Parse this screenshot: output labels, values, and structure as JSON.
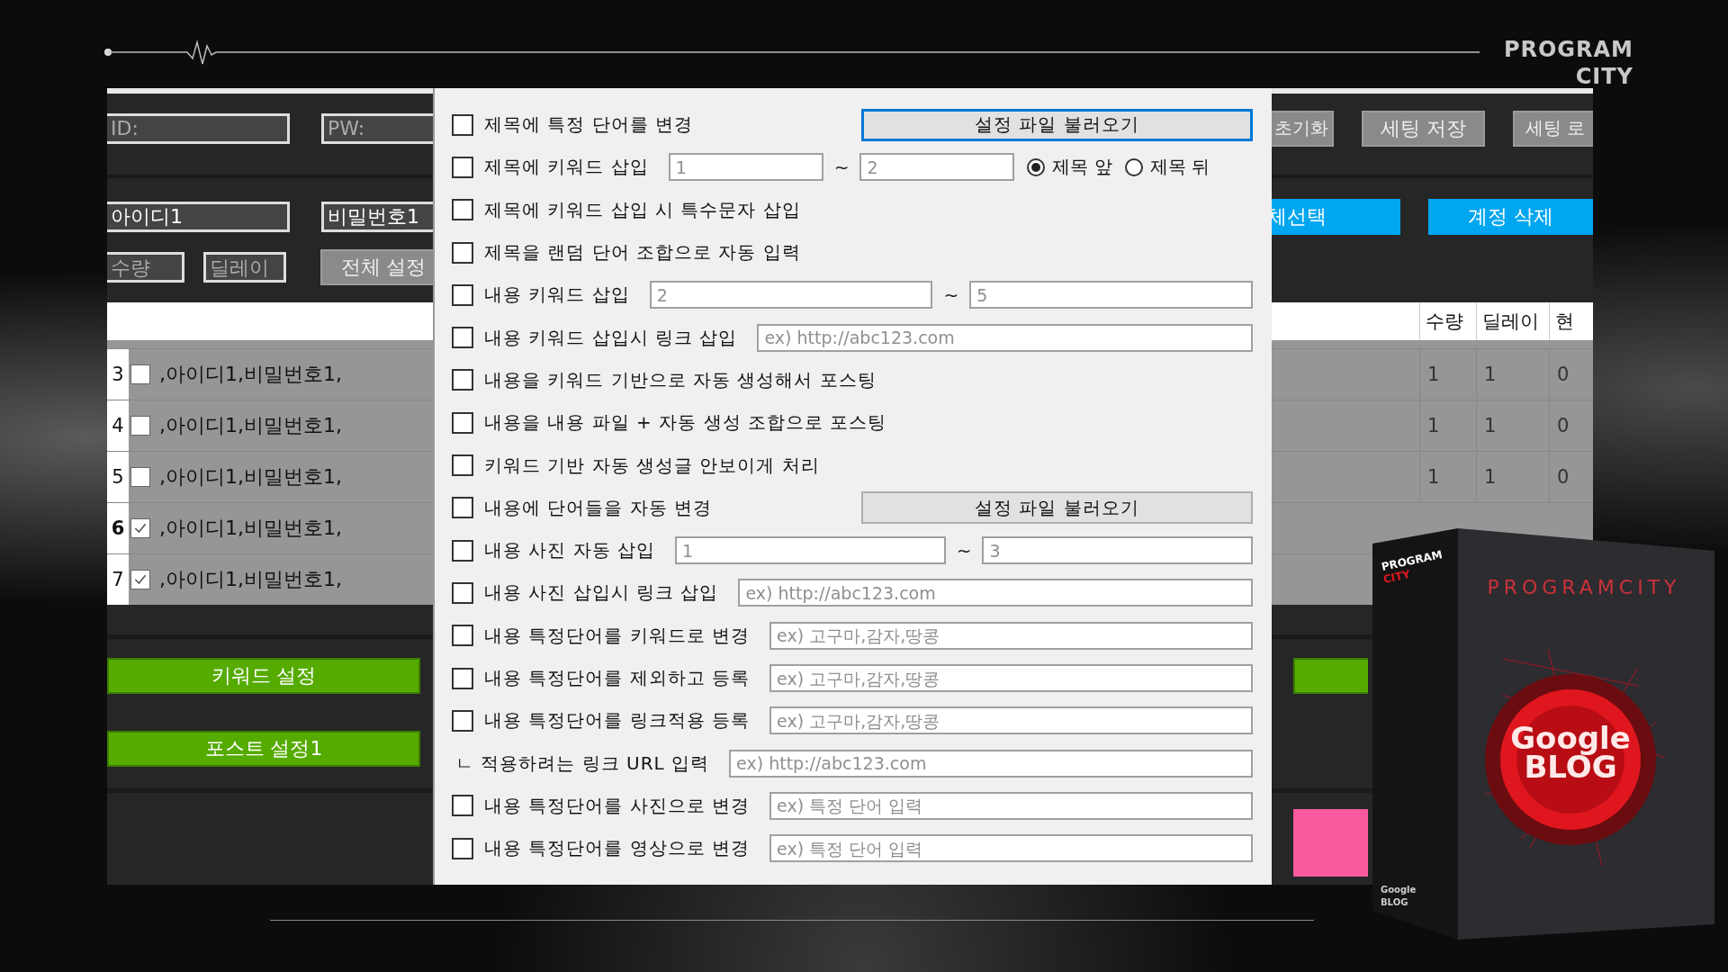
{
  "logo": {
    "lines": [
      "PROGRAM",
      "CITY"
    ]
  },
  "app": {
    "toolbar": {
      "id_field": {
        "placeholder": "ID:"
      },
      "pw_field": {
        "placeholder": "PW:"
      },
      "buttons": [
        "초기화",
        "세팅 저장",
        "세팅 로"
      ]
    },
    "account": {
      "id_value": "아이디1",
      "pw_value": "비밀번호1",
      "buttons": [
        "체선택",
        "계정 삭제"
      ]
    },
    "settings": {
      "qty_field": {
        "placeholder": "수량"
      },
      "delay_field": {
        "placeholder": "딜레이"
      },
      "apply_button": "전체 설정"
    },
    "table": {
      "columns": [
        "수량",
        "딜레이",
        "현"
      ],
      "rows": [
        {
          "number": "3",
          "checked": false,
          "selected": false,
          "account": ",아이디1,비밀번호1,",
          "values": [
            "1",
            "1",
            "0"
          ]
        },
        {
          "number": "4",
          "checked": false,
          "selected": false,
          "account": ",아이디1,비밀번호1,",
          "values": [
            "1",
            "1",
            "0"
          ]
        },
        {
          "number": "5",
          "checked": false,
          "selected": false,
          "account": ",아이디1,비밀번호1,",
          "values": [
            "1",
            "1",
            "0"
          ]
        },
        {
          "number": "6",
          "checked": true,
          "selected": true,
          "account": ",아이디1,비밀번호1,"
        },
        {
          "number": "7",
          "checked": true,
          "selected": false,
          "account": ",아이디1,비밀번호1,"
        }
      ]
    },
    "green_buttons": [
      "키워드 설정",
      "포스트 설정1"
    ]
  },
  "dialog": {
    "rows": [
      {
        "kind": "button",
        "checked": false,
        "label": "제목에 특정 단어를 변경",
        "button": "설정 파일 불러오기",
        "focused": true
      },
      {
        "kind": "range_radio",
        "checked": false,
        "label": "제목에 키워드 삽입",
        "from": "1",
        "to": "2",
        "separator": "~",
        "options": [
          {
            "label": "제목 앞",
            "selected": true
          },
          {
            "label": "제목 뒤",
            "selected": false
          }
        ]
      },
      {
        "kind": "check",
        "checked": false,
        "label": "제목에 키워드 삽입 시 특수문자 삽입"
      },
      {
        "kind": "check",
        "checked": false,
        "label": "제목을 랜덤 단어 조합으로 자동 입력"
      },
      {
        "kind": "range",
        "checked": false,
        "label": "내용 키워드 삽입",
        "from": "2",
        "to": "5",
        "separator": "~"
      },
      {
        "kind": "field",
        "checked": false,
        "label": "내용 키워드 삽입시 링크 삽입",
        "placeholder": "ex) http://abc123.com"
      },
      {
        "kind": "check",
        "checked": false,
        "label": "내용을 키워드 기반으로 자동 생성해서 포스팅"
      },
      {
        "kind": "check",
        "checked": false,
        "label": "내용을 내용 파일 + 자동 생성 조합으로 포스팅"
      },
      {
        "kind": "check",
        "checked": false,
        "label": "키워드 기반 자동 생성글 안보이게 처리"
      },
      {
        "kind": "button",
        "checked": false,
        "label": "내용에 단어들을 자동 변경",
        "button": "설정 파일 불러오기",
        "focused": false
      },
      {
        "kind": "range",
        "checked": false,
        "label": "내용 사진 자동 삽입",
        "from": "1",
        "to": "3",
        "separator": "~"
      },
      {
        "kind": "field",
        "checked": false,
        "label": "내용 사진 삽입시 링크 삽입",
        "placeholder": "ex) http://abc123.com"
      },
      {
        "kind": "field",
        "checked": false,
        "label": "내용 특정단어를 키워드로 변경",
        "placeholder": "ex) 고구마,감자,땅콩"
      },
      {
        "kind": "field",
        "checked": false,
        "label": "내용 특정단어를 제외하고 등록",
        "placeholder": "ex) 고구마,감자,땅콩"
      },
      {
        "kind": "field",
        "checked": false,
        "label": "내용 특정단어를 링크적용 등록",
        "placeholder": "ex) 고구마,감자,땅콩"
      },
      {
        "kind": "sub_field",
        "label": "ㄴ 적용하려는 링크 URL 입력",
        "placeholder": "ex) http://abc123.com"
      },
      {
        "kind": "field",
        "checked": false,
        "label": "내용 특정단어를 사진으로 변경",
        "placeholder": "ex) 특정 단어 입력"
      },
      {
        "kind": "field",
        "checked": false,
        "label": "내용 특정단어를 영상으로 변경",
        "placeholder": "ex) 특정 단어 입력"
      }
    ]
  },
  "product_box": {
    "side_brand": [
      "PROGRAM",
      "CITY"
    ],
    "title": "PROGRAMCITY",
    "logo": [
      "Google",
      "BLOG"
    ],
    "side_logo": [
      "Google",
      "BLOG"
    ]
  }
}
